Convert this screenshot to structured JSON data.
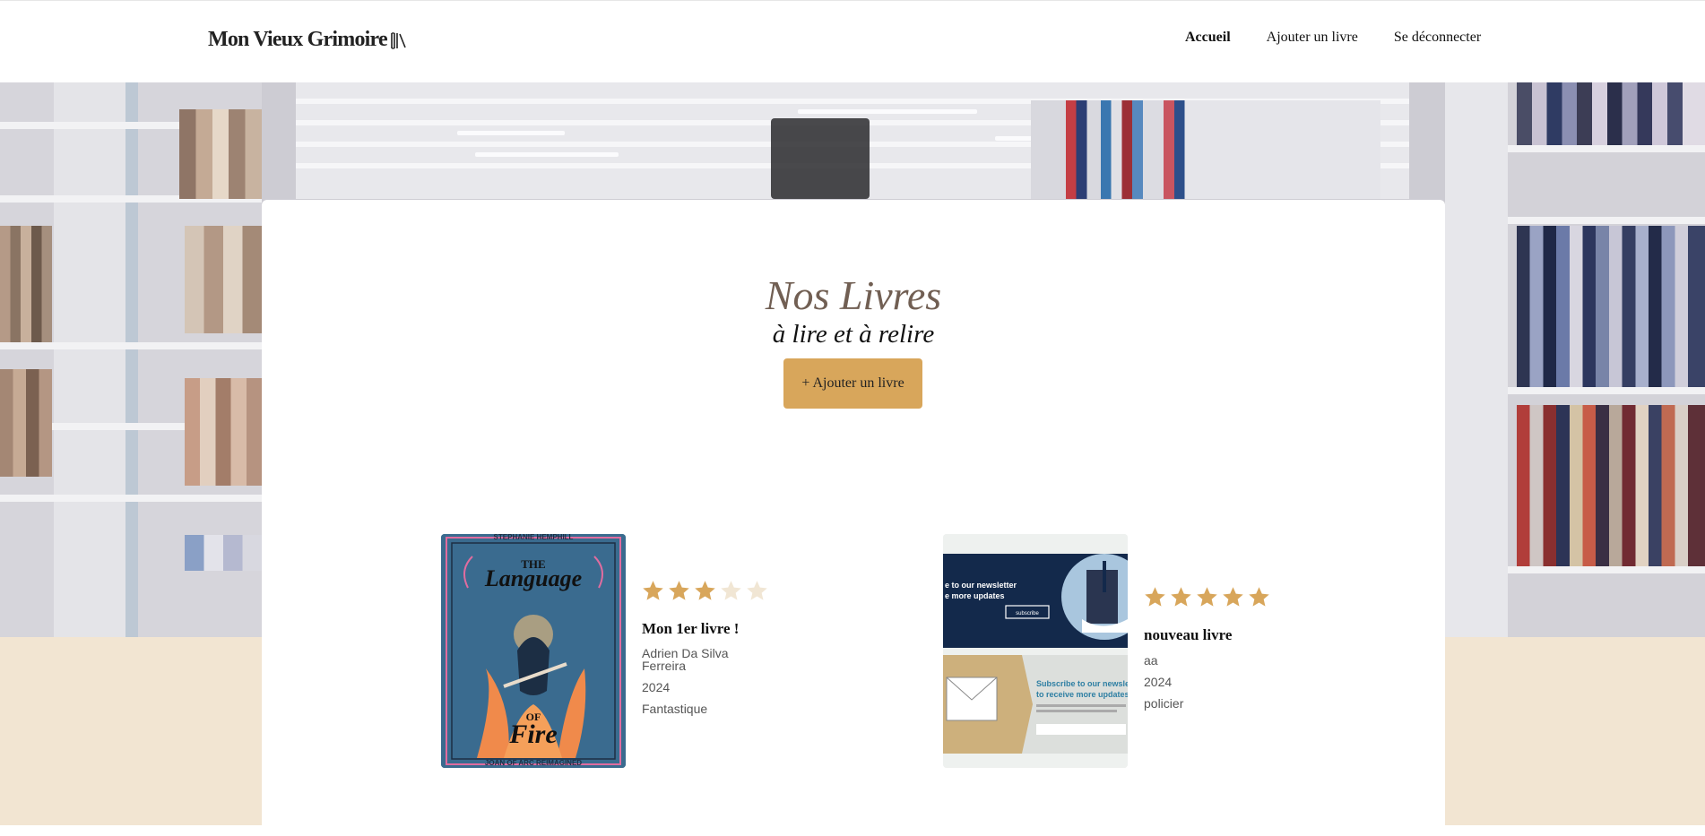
{
  "header": {
    "logo_text": "Mon Vieux Grimoire",
    "nav": [
      {
        "label": "Accueil",
        "active": true
      },
      {
        "label": "Ajouter un livre",
        "active": false
      },
      {
        "label": "Se déconnecter",
        "active": false
      }
    ]
  },
  "main": {
    "title": "Nos Livres",
    "subtitle": "à lire et à relire",
    "add_button": "+ Ajouter un livre"
  },
  "books": [
    {
      "title": "Mon 1er livre !",
      "author": "Adrien Da Silva Ferreira",
      "year": "2024",
      "genre": "Fantastique",
      "rating": 3,
      "cover_text": {
        "top": "STEPHANIE HEMPHILL",
        "line1": "THE",
        "line2": "Language",
        "line3": "OF",
        "line4": "Fire",
        "bottom": "JOAN OF ARC REIMAGINED"
      }
    },
    {
      "title": "nouveau livre",
      "author": "aa",
      "year": "2024",
      "genre": "policier",
      "rating": 5,
      "cover_text": {
        "top_heading_1": "e to our newsletter",
        "top_heading_2": "e more updates",
        "top_button": "subscribe",
        "bottom_heading_1": "Subscribe to our newsle",
        "bottom_heading_2": "to receive more updates"
      }
    }
  ],
  "colors": {
    "accent": "#d8a65b",
    "star_filled": "#d8a65b",
    "star_empty": "#f1e6d4",
    "title": "#715f53",
    "beige_band": "#f2e5d2"
  }
}
